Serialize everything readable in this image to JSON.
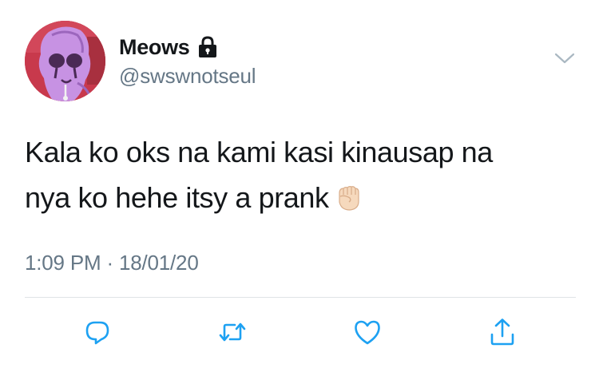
{
  "user": {
    "display_name": "Meows",
    "handle": "@swswnotseul",
    "protected_icon": "lock-icon",
    "avatar": "cartoon-avatar"
  },
  "tweet": {
    "lines": [
      "Kala ko oks na kami kasi kinausap na",
      "nya ko hehe itsy a prank"
    ],
    "emoji": "raised-fist-emoji",
    "time": "1:09 PM",
    "separator": "·",
    "date": "18/01/20"
  },
  "menu_icon": "chevron-down-icon",
  "actions": [
    {
      "icon": "reply-icon"
    },
    {
      "icon": "retweet-icon"
    },
    {
      "icon": "like-icon"
    },
    {
      "icon": "share-icon"
    }
  ],
  "colors": {
    "text": "#14171a",
    "secondary": "#657786",
    "icon": "#1da1f2",
    "divider": "#dfe3e6"
  }
}
